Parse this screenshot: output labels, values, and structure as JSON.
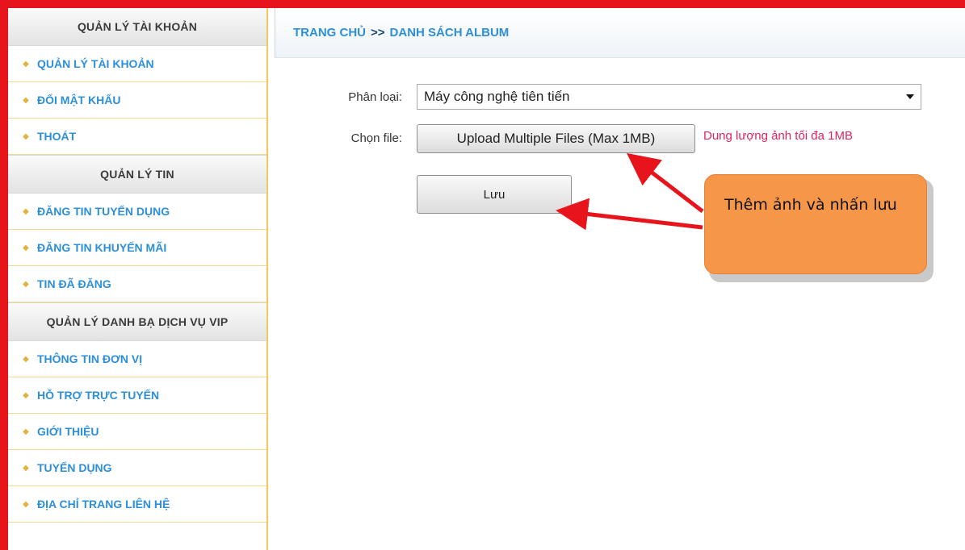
{
  "sidebar": {
    "sections": [
      {
        "title": "QUẢN LÝ TÀI KHOẢN",
        "items": [
          "QUẢN LÝ TÀI KHOẢN",
          "ĐỔI MẬT KHẨU",
          "THOÁT"
        ]
      },
      {
        "title": "QUẢN LÝ TIN",
        "items": [
          "ĐĂNG TIN TUYỂN DỤNG",
          "ĐĂNG TIN KHUYẾN MÃI",
          "TIN ĐÃ ĐĂNG"
        ]
      },
      {
        "title": "QUẢN LÝ DANH BẠ DỊCH VỤ VIP",
        "items": [
          "THÔNG TIN ĐƠN VỊ",
          "HỖ TRỢ TRỰC TUYẾN",
          "GIỚI THIỆU",
          "TUYỂN DỤNG",
          "ĐỊA CHỈ TRANG LIÊN HỆ"
        ]
      }
    ],
    "bullet_icon": "diamond-bullet-icon"
  },
  "breadcrumb": {
    "home": "TRANG CHỦ",
    "separator": ">>",
    "current": "DANH SÁCH ALBUM"
  },
  "form": {
    "category_label": "Phân loại:",
    "category_value": "Máy công nghệ tiên tiến",
    "file_label": "Chọn file:",
    "upload_button": "Upload Multiple Files (Max 1MB)",
    "size_hint": "Dung lượng ảnh tối đa 1MB",
    "save_button": "Lưu"
  },
  "callout": {
    "text": "Thêm ảnh và nhấn lưu"
  },
  "colors": {
    "frame": "#e8141b",
    "link": "#2d8fd8",
    "hint": "#e0245e",
    "callout": "#f59648",
    "arrow": "#e8141b"
  }
}
